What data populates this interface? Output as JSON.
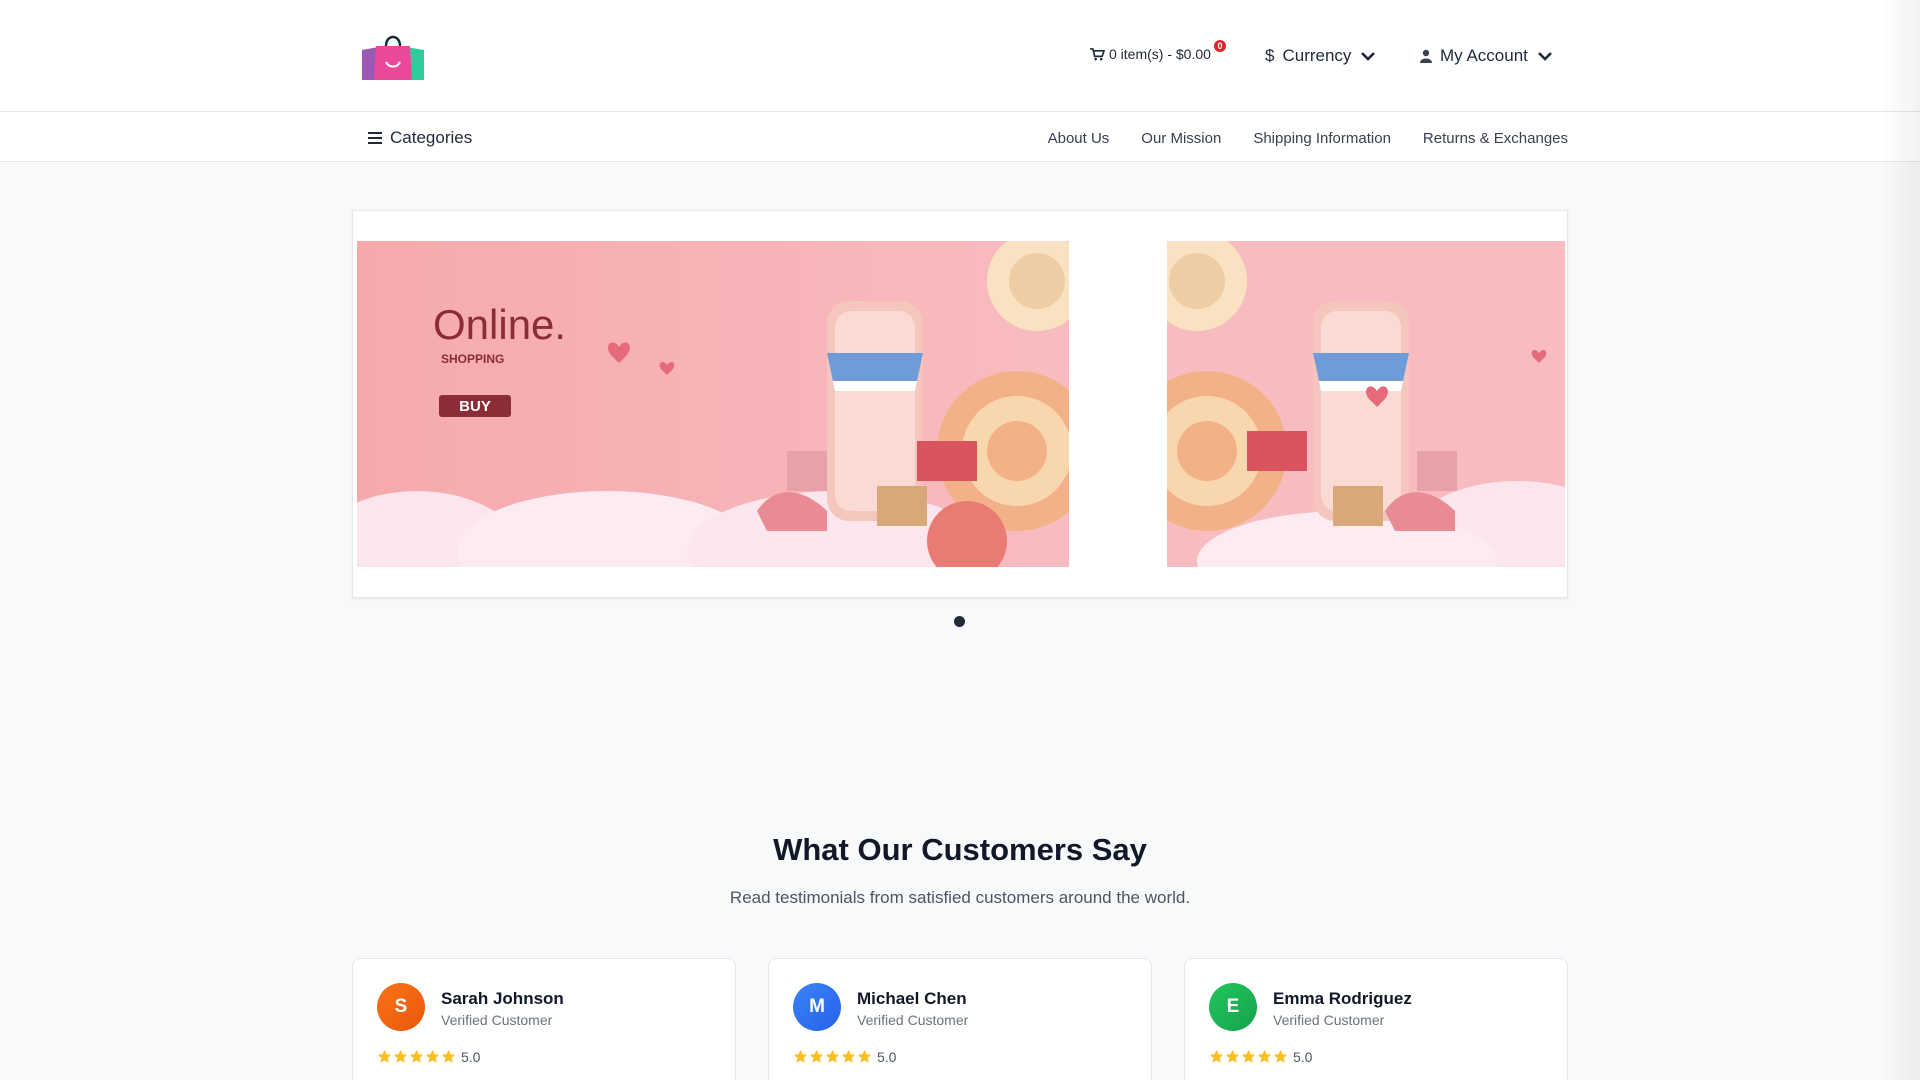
{
  "header": {
    "cart_text": "0 item(s) - $0.00",
    "cart_badge": "0",
    "currency_label": "Currency",
    "currency_symbol": "$",
    "account_label": "My Account"
  },
  "nav": {
    "categories_label": "Categories",
    "links": [
      "About Us",
      "Our Mission",
      "Shipping Information",
      "Returns & Exchanges"
    ]
  },
  "banner": {
    "headline": "Online.",
    "subline": "SHOPPING",
    "button": "BUY",
    "slide_count": 1,
    "active_slide": 1
  },
  "testimonials": {
    "title": "What Our Customers Say",
    "subtitle": "Read testimonials from satisfied customers around the world.",
    "items": [
      {
        "initial": "S",
        "name": "Sarah Johnson",
        "role": "Verified Customer",
        "rating": "5.0",
        "color": "#f97316"
      },
      {
        "initial": "M",
        "name": "Michael Chen",
        "role": "Verified Customer",
        "rating": "5.0",
        "color": "#3b82f6"
      },
      {
        "initial": "E",
        "name": "Emma Rodriguez",
        "role": "Verified Customer",
        "rating": "5.0",
        "color": "#22c55e"
      }
    ]
  },
  "colors": {
    "brand_pink": "#ec4899",
    "star": "#fbbf24",
    "badge": "#dc2626"
  }
}
